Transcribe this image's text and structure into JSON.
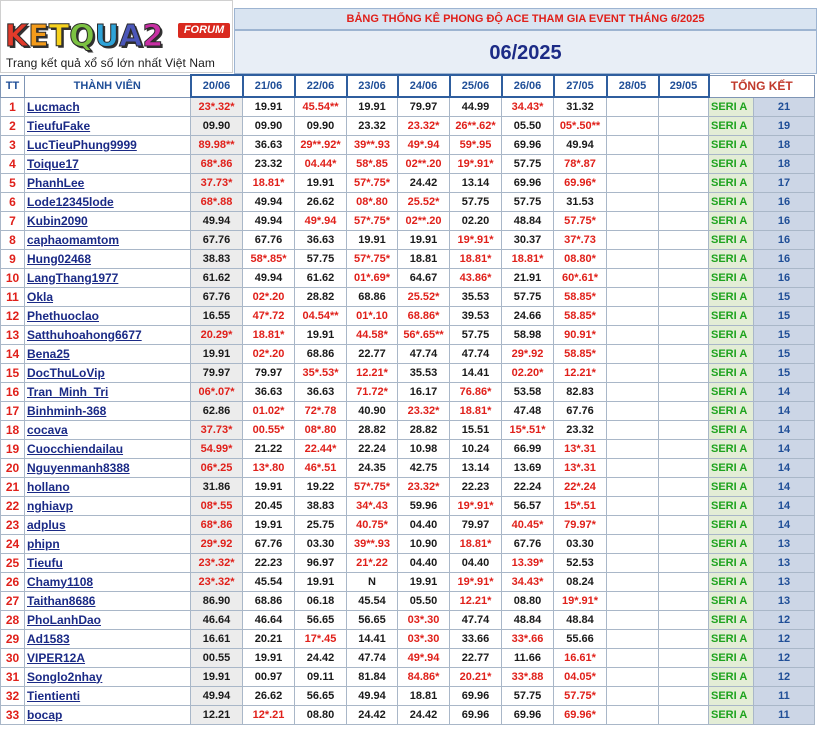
{
  "logo": {
    "letters": [
      "K",
      "E",
      "T",
      "Q",
      "U",
      "A",
      "2"
    ],
    "forum": "FORUM",
    "tagline": "Trang kết quả xổ số lớn nhất Việt Nam"
  },
  "banner": "BẢNG THỐNG KÊ PHONG ĐỘ ACE THAM GIA EVENT THÁNG 6/2025",
  "month": "06/2025",
  "headers": {
    "tt": "TT",
    "member": "THÀNH VIÊN",
    "dates": [
      "20/06",
      "21/06",
      "22/06",
      "23/06",
      "24/06",
      "25/06",
      "26/06",
      "27/05",
      "28/05",
      "29/05"
    ],
    "total": "TỔNG KẾT"
  },
  "rows": [
    {
      "tt": "1",
      "name": "Lucmach",
      "vals": [
        "23*.32*",
        "19.91",
        "45.54**",
        "19.91",
        "79.97",
        "44.99",
        "34.43*",
        "31.32",
        "",
        ""
      ],
      "hits": [
        1,
        0,
        1,
        0,
        0,
        0,
        1,
        0,
        0,
        0
      ],
      "seri": "SERI A",
      "total": "21"
    },
    {
      "tt": "2",
      "name": "TieufuFake",
      "vals": [
        "09.90",
        "09.90",
        "09.90",
        "23.32",
        "23.32*",
        "26**.62*",
        "05.50",
        "05*.50**",
        "",
        ""
      ],
      "hits": [
        0,
        0,
        0,
        0,
        1,
        1,
        0,
        1,
        0,
        0
      ],
      "seri": "SERI A",
      "total": "19"
    },
    {
      "tt": "3",
      "name": "LucTieuPhung9999",
      "vals": [
        "89.98**",
        "36.63",
        "29**.92*",
        "39**.93",
        "49*.94",
        "59*.95",
        "69.96",
        "49.94",
        "",
        ""
      ],
      "hits": [
        1,
        0,
        1,
        1,
        1,
        1,
        0,
        0,
        0,
        0
      ],
      "seri": "SERI A",
      "total": "18"
    },
    {
      "tt": "4",
      "name": "Toique17",
      "vals": [
        "68*.86",
        "23.32",
        "04.44*",
        "58*.85",
        "02**.20",
        "19*.91*",
        "57.75",
        "78*.87",
        "",
        ""
      ],
      "hits": [
        1,
        0,
        1,
        1,
        1,
        1,
        0,
        1,
        0,
        0
      ],
      "seri": "SERI A",
      "total": "18"
    },
    {
      "tt": "5",
      "name": "PhanhLee",
      "vals": [
        "37.73*",
        "18.81*",
        "19.91",
        "57*.75*",
        "24.42",
        "13.14",
        "69.96",
        "69.96*",
        "",
        ""
      ],
      "hits": [
        1,
        1,
        0,
        1,
        0,
        0,
        0,
        1,
        0,
        0
      ],
      "seri": "SERI A",
      "total": "17"
    },
    {
      "tt": "6",
      "name": "Lode12345lode",
      "vals": [
        "68*.88",
        "49.94",
        "26.62",
        "08*.80",
        "25.52*",
        "57.75",
        "57.75",
        "31.53",
        "",
        ""
      ],
      "hits": [
        1,
        0,
        0,
        1,
        1,
        0,
        0,
        0,
        0,
        0
      ],
      "seri": "SERI A",
      "total": "16"
    },
    {
      "tt": "7",
      "name": "Kubin2090",
      "vals": [
        "49.94",
        "49.94",
        "49*.94",
        "57*.75*",
        "02**.20",
        "02.20",
        "48.84",
        "57.75*",
        "",
        ""
      ],
      "hits": [
        0,
        0,
        1,
        1,
        1,
        0,
        0,
        1,
        0,
        0
      ],
      "seri": "SERI A",
      "total": "16"
    },
    {
      "tt": "8",
      "name": "caphaomamtom",
      "vals": [
        "67.76",
        "67.76",
        "36.63",
        "19.91",
        "19.91",
        "19*.91*",
        "30.37",
        "37*.73",
        "",
        ""
      ],
      "hits": [
        0,
        0,
        0,
        0,
        0,
        1,
        0,
        1,
        0,
        0
      ],
      "seri": "SERI A",
      "total": "16"
    },
    {
      "tt": "9",
      "name": "Hung02468",
      "vals": [
        "38.83",
        "58*.85*",
        "57.75",
        "57*.75*",
        "18.81",
        "18.81*",
        "18.81*",
        "08.80*",
        "",
        ""
      ],
      "hits": [
        0,
        1,
        0,
        1,
        0,
        1,
        1,
        1,
        0,
        0
      ],
      "seri": "SERI A",
      "total": "16"
    },
    {
      "tt": "10",
      "name": "LangThang1977",
      "vals": [
        "61.62",
        "49.94",
        "61.62",
        "01*.69*",
        "64.67",
        "43.86*",
        "21.91",
        "60*.61*",
        "",
        ""
      ],
      "hits": [
        0,
        0,
        0,
        1,
        0,
        1,
        0,
        1,
        0,
        0
      ],
      "seri": "SERI A",
      "total": "16"
    },
    {
      "tt": "11",
      "name": "Okla",
      "vals": [
        "67.76",
        "02*.20",
        "28.82",
        "68.86",
        "25.52*",
        "35.53",
        "57.75",
        "58.85*",
        "",
        ""
      ],
      "hits": [
        0,
        1,
        0,
        0,
        1,
        0,
        0,
        1,
        0,
        0
      ],
      "seri": "SERI A",
      "total": "15"
    },
    {
      "tt": "12",
      "name": "Phethuoclao",
      "vals": [
        "16.55",
        "47*.72",
        "04.54**",
        "01*.10",
        "68.86*",
        "39.53",
        "24.66",
        "58.85*",
        "",
        ""
      ],
      "hits": [
        0,
        1,
        1,
        1,
        1,
        0,
        0,
        1,
        0,
        0
      ],
      "seri": "SERI A",
      "total": "15"
    },
    {
      "tt": "13",
      "name": "Satthuhoahong6677",
      "vals": [
        "20.29*",
        "18.81*",
        "19.91",
        "44.58*",
        "56*.65**",
        "57.75",
        "58.98",
        "90.91*",
        "",
        ""
      ],
      "hits": [
        1,
        1,
        0,
        1,
        1,
        0,
        0,
        1,
        0,
        0
      ],
      "seri": "SERI A",
      "total": "15"
    },
    {
      "tt": "14",
      "name": "Bena25",
      "vals": [
        "19.91",
        "02*.20",
        "68.86",
        "22.77",
        "47.74",
        "47.74",
        "29*.92",
        "58.85*",
        "",
        ""
      ],
      "hits": [
        0,
        1,
        0,
        0,
        0,
        0,
        1,
        1,
        0,
        0
      ],
      "seri": "SERI A",
      "total": "15"
    },
    {
      "tt": "15",
      "name": "DocThuLoVip",
      "vals": [
        "79.97",
        "79.97",
        "35*.53*",
        "12.21*",
        "35.53",
        "14.41",
        "02.20*",
        "12.21*",
        "",
        ""
      ],
      "hits": [
        0,
        0,
        1,
        1,
        0,
        0,
        1,
        1,
        0,
        0
      ],
      "seri": "SERI A",
      "total": "15"
    },
    {
      "tt": "16",
      "name": "Tran_Minh_Tri",
      "vals": [
        "06*.07*",
        "36.63",
        "36.63",
        "71.72*",
        "16.17",
        "76.86*",
        "53.58",
        "82.83",
        "",
        ""
      ],
      "hits": [
        1,
        0,
        0,
        1,
        0,
        1,
        0,
        0,
        0,
        0
      ],
      "seri": "SERI A",
      "total": "14"
    },
    {
      "tt": "17",
      "name": "Binhminh-368",
      "vals": [
        "62.86",
        "01.02*",
        "72*.78",
        "40.90",
        "23.32*",
        "18.81*",
        "47.48",
        "67.76",
        "",
        ""
      ],
      "hits": [
        0,
        1,
        1,
        0,
        1,
        1,
        0,
        0,
        0,
        0
      ],
      "seri": "SERI A",
      "total": "14"
    },
    {
      "tt": "18",
      "name": "cocava",
      "vals": [
        "37.73*",
        "00.55*",
        "08*.80",
        "28.82",
        "28.82",
        "15.51",
        "15*.51*",
        "23.32",
        "",
        ""
      ],
      "hits": [
        1,
        1,
        1,
        0,
        0,
        0,
        1,
        0,
        0,
        0
      ],
      "seri": "SERI A",
      "total": "14"
    },
    {
      "tt": "19",
      "name": "Cuocchiendailau",
      "vals": [
        "54.99*",
        "21.22",
        "22.44*",
        "22.24",
        "10.98",
        "10.24",
        "66.99",
        "13*.31",
        "",
        ""
      ],
      "hits": [
        1,
        0,
        1,
        0,
        0,
        0,
        0,
        1,
        0,
        0
      ],
      "seri": "SERI A",
      "total": "14"
    },
    {
      "tt": "20",
      "name": "Nguyenmanh8388",
      "vals": [
        "06*.25",
        "13*.80",
        "46*.51",
        "24.35",
        "42.75",
        "13.14",
        "13.69",
        "13*.31",
        "",
        ""
      ],
      "hits": [
        1,
        1,
        1,
        0,
        0,
        0,
        0,
        1,
        0,
        0
      ],
      "seri": "SERI A",
      "total": "14"
    },
    {
      "tt": "21",
      "name": "hollano",
      "vals": [
        "31.86",
        "19.91",
        "19.22",
        "57*.75*",
        "23.32*",
        "22.23",
        "22.24",
        "22*.24",
        "",
        ""
      ],
      "hits": [
        0,
        0,
        0,
        1,
        1,
        0,
        0,
        1,
        0,
        0
      ],
      "seri": "SERI A",
      "total": "14"
    },
    {
      "tt": "22",
      "name": "nghiavp",
      "vals": [
        "08*.55",
        "20.45",
        "38.83",
        "34*.43",
        "59.96",
        "19*.91*",
        "56.57",
        "15*.51",
        "",
        ""
      ],
      "hits": [
        1,
        0,
        0,
        1,
        0,
        1,
        0,
        1,
        0,
        0
      ],
      "seri": "SERI A",
      "total": "14"
    },
    {
      "tt": "23",
      "name": "adplus",
      "vals": [
        "68*.86",
        "19.91",
        "25.75",
        "40.75*",
        "04.40",
        "79.97",
        "40.45*",
        "79.97*",
        "",
        ""
      ],
      "hits": [
        1,
        0,
        0,
        1,
        0,
        0,
        1,
        1,
        0,
        0
      ],
      "seri": "SERI A",
      "total": "14"
    },
    {
      "tt": "24",
      "name": "phipn",
      "vals": [
        "29*.92",
        "67.76",
        "03.30",
        "39**.93",
        "10.90",
        "18.81*",
        "67.76",
        "03.30",
        "",
        ""
      ],
      "hits": [
        1,
        0,
        0,
        1,
        0,
        1,
        0,
        0,
        0,
        0
      ],
      "seri": "SERI A",
      "total": "13"
    },
    {
      "tt": "25",
      "name": "Tieufu",
      "vals": [
        "23*.32*",
        "22.23",
        "96.97",
        "21*.22",
        "04.40",
        "04.40",
        "13.39*",
        "52.53",
        "",
        ""
      ],
      "hits": [
        1,
        0,
        0,
        1,
        0,
        0,
        1,
        0,
        0,
        0
      ],
      "seri": "SERI A",
      "total": "13"
    },
    {
      "tt": "26",
      "name": "Chamy1108",
      "vals": [
        "23*.32*",
        "45.54",
        "19.91",
        "N",
        "19.91",
        "19*.91*",
        "34.43*",
        "08.24",
        "",
        ""
      ],
      "hits": [
        1,
        0,
        0,
        0,
        0,
        1,
        1,
        0,
        0,
        0
      ],
      "seri": "SERI A",
      "total": "13"
    },
    {
      "tt": "27",
      "name": "Taithan8686",
      "vals": [
        "86.90",
        "68.86",
        "06.18",
        "45.54",
        "05.50",
        "12.21*",
        "08.80",
        "19*.91*",
        "",
        ""
      ],
      "hits": [
        0,
        0,
        0,
        0,
        0,
        1,
        0,
        1,
        0,
        0
      ],
      "seri": "SERI A",
      "total": "13"
    },
    {
      "tt": "28",
      "name": "PhoLanhDao",
      "vals": [
        "46.64",
        "46.64",
        "56.65",
        "56.65",
        "03*.30",
        "47.74",
        "48.84",
        "48.84",
        "",
        ""
      ],
      "hits": [
        0,
        0,
        0,
        0,
        1,
        0,
        0,
        0,
        0,
        0
      ],
      "seri": "SERI A",
      "total": "12"
    },
    {
      "tt": "29",
      "name": "Ad1583",
      "vals": [
        "16.61",
        "20.21",
        "17*.45",
        "14.41",
        "03*.30",
        "33.66",
        "33*.66",
        "55.66",
        "",
        ""
      ],
      "hits": [
        0,
        0,
        1,
        0,
        1,
        0,
        1,
        0,
        0,
        0
      ],
      "seri": "SERI A",
      "total": "12"
    },
    {
      "tt": "30",
      "name": "VIPER12A",
      "vals": [
        "00.55",
        "19.91",
        "24.42",
        "47.74",
        "49*.94",
        "22.77",
        "11.66",
        "16.61*",
        "",
        ""
      ],
      "hits": [
        0,
        0,
        0,
        0,
        1,
        0,
        0,
        1,
        0,
        0
      ],
      "seri": "SERI A",
      "total": "12"
    },
    {
      "tt": "31",
      "name": "Songlo2nhay",
      "vals": [
        "19.91",
        "00.97",
        "09.11",
        "81.84",
        "84.86*",
        "20.21*",
        "33*.88",
        "04.05*",
        "",
        ""
      ],
      "hits": [
        0,
        0,
        0,
        0,
        1,
        1,
        1,
        1,
        0,
        0
      ],
      "seri": "SERI A",
      "total": "12"
    },
    {
      "tt": "32",
      "name": "Tientienti",
      "vals": [
        "49.94",
        "26.62",
        "56.65",
        "49.94",
        "18.81",
        "69.96",
        "57.75",
        "57.75*",
        "",
        ""
      ],
      "hits": [
        0,
        0,
        0,
        0,
        0,
        0,
        0,
        1,
        0,
        0
      ],
      "seri": "SERI A",
      "total": "11"
    },
    {
      "tt": "33",
      "name": "bocap",
      "vals": [
        "12.21",
        "12*.21",
        "08.80",
        "24.42",
        "24.42",
        "69.96",
        "69.96",
        "69.96*",
        "",
        ""
      ],
      "hits": [
        0,
        1,
        0,
        0,
        0,
        0,
        0,
        1,
        0,
        0
      ],
      "seri": "SERI A",
      "total": "11"
    }
  ]
}
